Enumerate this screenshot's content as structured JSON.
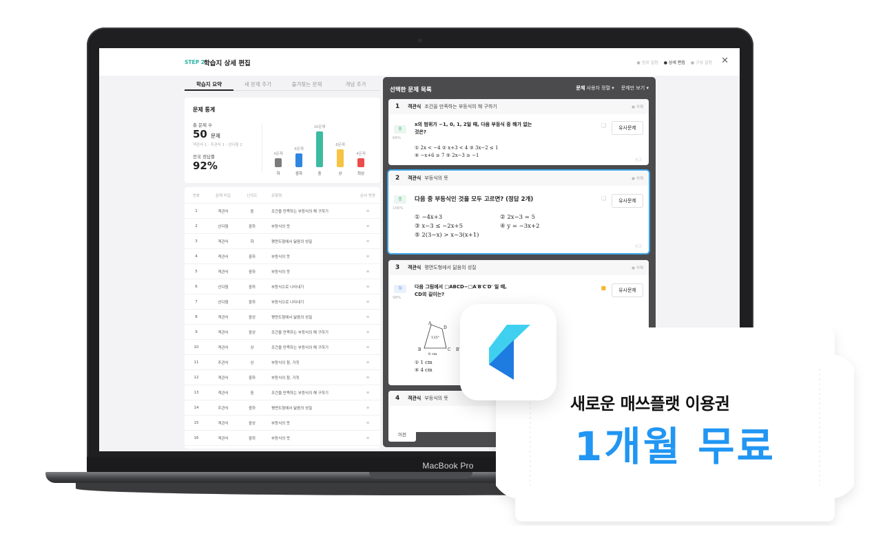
{
  "device": {
    "brand": "MacBook Pro"
  },
  "header": {
    "step": "STEP 2",
    "title": "학습지 상세 편집",
    "steps": [
      "범위 설정",
      "상세 편집",
      "구성 설정"
    ],
    "close_icon": "close-icon"
  },
  "tabs": [
    "학습지 요약",
    "새 문제 추가",
    "즐겨찾는 문제",
    "개념 추가"
  ],
  "stats": {
    "title": "문제 통계",
    "total_label": "총 문제 수",
    "total_value": "50",
    "total_unit": "문제",
    "breakdown": "객관식 1 · 주관식 1 · 선다형 2",
    "accuracy_label": "전국 정답률",
    "accuracy_value": "92%",
    "bars": [
      {
        "name": "하",
        "count": "4문제",
        "value": 4,
        "color": "#7b7b7b"
      },
      {
        "name": "중하",
        "count": "6문제",
        "value": 6,
        "color": "#2f86e0"
      },
      {
        "name": "중",
        "count": "16문제",
        "value": 16,
        "color": "#3dbba2"
      },
      {
        "name": "상",
        "count": "8문제",
        "value": 8,
        "color": "#f6c343"
      },
      {
        "name": "최상",
        "count": "4문제",
        "value": 4,
        "color": "#ec4b4b"
      }
    ]
  },
  "table": {
    "headers": [
      "번호",
      "문제 타입",
      "난이도",
      "유형명",
      "순서 변경"
    ],
    "rows": [
      [
        "1",
        "객관식",
        "중",
        "조건을 만족하는 부등식의 해 구하기"
      ],
      [
        "2",
        "선다형",
        "중하",
        "부등식의 뜻"
      ],
      [
        "3",
        "객관식",
        "하",
        "평면도형에서 닮음의 성질"
      ],
      [
        "4",
        "객관식",
        "중하",
        "부등식의 뜻"
      ],
      [
        "5",
        "객관식",
        "중하",
        "부등식의 뜻"
      ],
      [
        "6",
        "선다형",
        "중하",
        "부등식으로 나타내기"
      ],
      [
        "7",
        "선다형",
        "중하",
        "부등식으로 나타내기"
      ],
      [
        "8",
        "객관식",
        "중상",
        "평면도형에서 닮음의 성질"
      ],
      [
        "9",
        "객관식",
        "중상",
        "조건을 만족하는 부등식의 해 구하기"
      ],
      [
        "10",
        "객관식",
        "상",
        "조건을 만족하는 부등식의 해 구하기"
      ],
      [
        "11",
        "주관식",
        "상",
        "부등식의 참, 거짓"
      ],
      [
        "12",
        "객관식",
        "중하",
        "부등식의 참, 거짓"
      ],
      [
        "13",
        "객관식",
        "중",
        "조건을 만족하는 부등식의 해 구하기"
      ],
      [
        "14",
        "주관식",
        "중하",
        "평면도형에서 닮음의 성질"
      ],
      [
        "15",
        "객관식",
        "중상",
        "부등식의 뜻"
      ],
      [
        "16",
        "객관식",
        "중하",
        "부등식의 뜻"
      ]
    ]
  },
  "panel": {
    "title": "선택한 문제 목록",
    "filter_label": "문제",
    "sort_label": "사용자 정렬",
    "view_label": "문제만 보기",
    "prev_label": "이전",
    "delete_label": "삭제",
    "similar_label": "유사문제",
    "report_label": "신고",
    "questions": [
      {
        "num": "1",
        "type": "객관식",
        "topic": "조건을 만족하는 부등식의 해 구하기",
        "level": "중",
        "rate": "66%",
        "text_1": "x의 범위가 −1, 0, 1, 2일 때, 다음 부등식 중 해가 없는",
        "text_2": "것은?",
        "opt_1": "① 2x < −4      ② x+3 < 4      ③ 3x−2 ≤ 1",
        "opt_2": "④ −x+6 ≥ 7    ⑤ 2x−3 ≥ −1"
      },
      {
        "num": "2",
        "type": "객관식",
        "topic": "부등식의 뜻",
        "level": "중",
        "rate": "100%",
        "text_1": "다음 중 부등식인 것을 모두 고르면? (정답 2개)",
        "opt_1": "① −4x+3",
        "opt_2": "② 2x−3 = 5",
        "opt_3": "③ x−3 ≤ −2x+5",
        "opt_4": "④ y = −3x+2",
        "opt_5": "⑤ 2(3−x) > x−3(x+1)"
      },
      {
        "num": "3",
        "type": "객관식",
        "topic": "평면도형에서 닮음의 성질",
        "level": "하",
        "rate": "98%",
        "text_1": "다음 그림에서 □ABCD∽□A′B′C′D′ 일 때,",
        "text_2": "CD의 길이는?",
        "fig_a": "A",
        "fig_d": "D",
        "fig_b": "B",
        "fig_c": "C",
        "fig_b2": "B′",
        "fig_angle": "135°",
        "fig_len": "6 cm",
        "opt_1": "① 1 cm",
        "opt_2": "④ 4 cm"
      },
      {
        "num": "4",
        "type": "객관식",
        "topic": "부등식의 뜻"
      }
    ]
  },
  "promo": {
    "line1": "새로운 매쓰플랫 이용권",
    "line2": "1개월 무료",
    "accent": "#2196f3"
  }
}
